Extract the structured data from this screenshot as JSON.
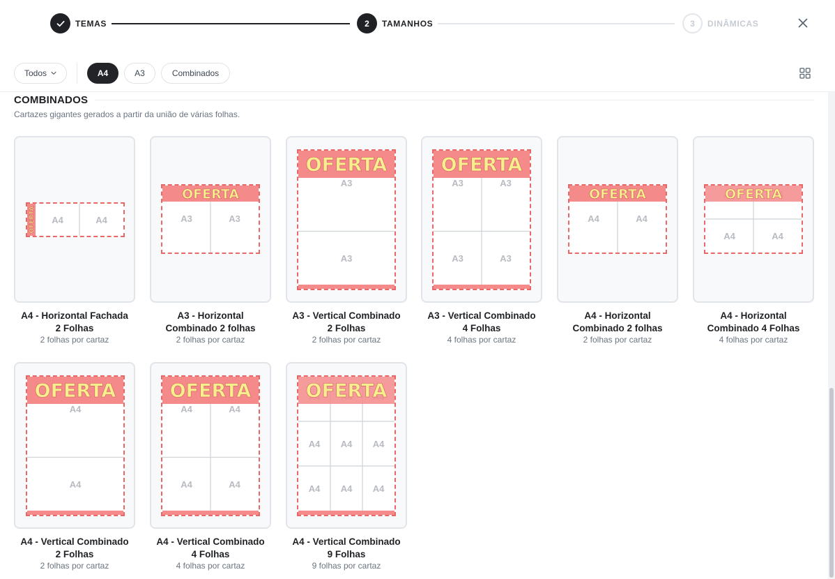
{
  "stepper": {
    "steps": [
      {
        "number": "1",
        "label": "TEMAS",
        "state": "done"
      },
      {
        "number": "2",
        "label": "TAMANHOS",
        "state": "active"
      },
      {
        "number": "3",
        "label": "DINÂMICAS",
        "state": "pending"
      }
    ],
    "close_icon": "close-icon"
  },
  "filters": {
    "all_label": "Todos",
    "chips": [
      "A4",
      "A3",
      "Combinados"
    ],
    "selected": "A4",
    "view_icon": "grid-view-icon"
  },
  "section": {
    "title": "COMBINADOS",
    "description": "Cartazes gigantes gerados a partir da união de várias folhas."
  },
  "poster": {
    "banner_text": "OFERTA",
    "banner_color": "#f58a8a",
    "dash_color": "#e86767"
  },
  "cards": [
    {
      "title_line1": "A4 - Horizontal Fachada",
      "title_line2": "2 Folhas",
      "subtitle": "2 folhas por cartaz",
      "sheet_label": "A4"
    },
    {
      "title_line1": "A3 - Horizontal",
      "title_line2": "Combinado 2 folhas",
      "subtitle": "2 folhas por cartaz",
      "sheet_label": "A3"
    },
    {
      "title_line1": "A3 - Vertical Combinado",
      "title_line2": "2 Folhas",
      "subtitle": "2 folhas por cartaz",
      "sheet_label": "A3"
    },
    {
      "title_line1": "A3 - Vertical Combinado",
      "title_line2": "4 Folhas",
      "subtitle": "4 folhas por cartaz",
      "sheet_label": "A3"
    },
    {
      "title_line1": "A4 - Horizontal",
      "title_line2": "Combinado 2 folhas",
      "subtitle": "2 folhas por cartaz",
      "sheet_label": "A4"
    },
    {
      "title_line1": "A4 - Horizontal",
      "title_line2": "Combinado 4 Folhas",
      "subtitle": "4 folhas por cartaz",
      "sheet_label": "A4"
    },
    {
      "title_line1": "A4 - Vertical Combinado",
      "title_line2": "2 Folhas",
      "subtitle": "2 folhas por cartaz",
      "sheet_label": "A4"
    },
    {
      "title_line1": "A4 - Vertical Combinado",
      "title_line2": "4 Folhas",
      "subtitle": "4 folhas por cartaz",
      "sheet_label": "A4"
    },
    {
      "title_line1": "A4 - Vertical Combinado",
      "title_line2": "9 Folhas",
      "subtitle": "9 folhas por cartaz",
      "sheet_label": "A4"
    }
  ]
}
